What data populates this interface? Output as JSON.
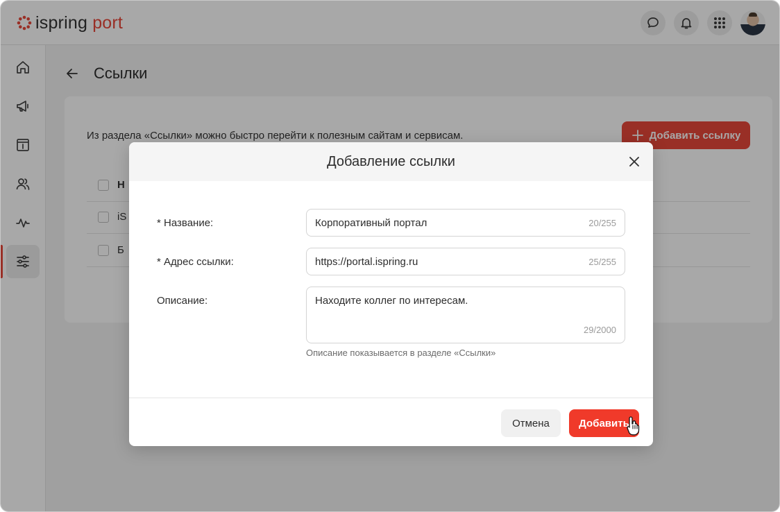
{
  "app": {
    "logo_main": "ispring",
    "logo_accent": "port",
    "brand_color": "#e8483b"
  },
  "header": {
    "icons": [
      "chat-icon",
      "bell-icon",
      "apps-grid-icon",
      "user-avatar"
    ]
  },
  "sidebar": {
    "items": [
      {
        "icon": "home-icon"
      },
      {
        "icon": "megaphone-icon"
      },
      {
        "icon": "info-box-icon"
      },
      {
        "icon": "users-icon"
      },
      {
        "icon": "activity-icon"
      },
      {
        "icon": "sliders-icon",
        "active": true
      }
    ]
  },
  "page": {
    "title": "Ссылки",
    "description": "Из раздела «Ссылки» можно быстро перейти к полезным сайтам и сервисам.",
    "add_button_label": "Добавить ссылку",
    "table": {
      "header_cell": "Н",
      "rows": [
        "iS",
        "Б"
      ]
    }
  },
  "modal": {
    "title": "Добавление ссылки",
    "fields": {
      "name": {
        "label": "* Название:",
        "value": "Корпоративный портал",
        "counter": "20/255"
      },
      "url": {
        "label": "* Адрес ссылки:",
        "value": "https://portal.ispring.ru",
        "counter": "25/255"
      },
      "description": {
        "label": "Описание:",
        "value": "Находите коллег по интересам.",
        "counter": "29/2000",
        "hint": "Описание показывается в разделе «Ссылки»"
      }
    },
    "cancel_label": "Отмена",
    "submit_label": "Добавить",
    "submit_color": "#f03a2a"
  }
}
